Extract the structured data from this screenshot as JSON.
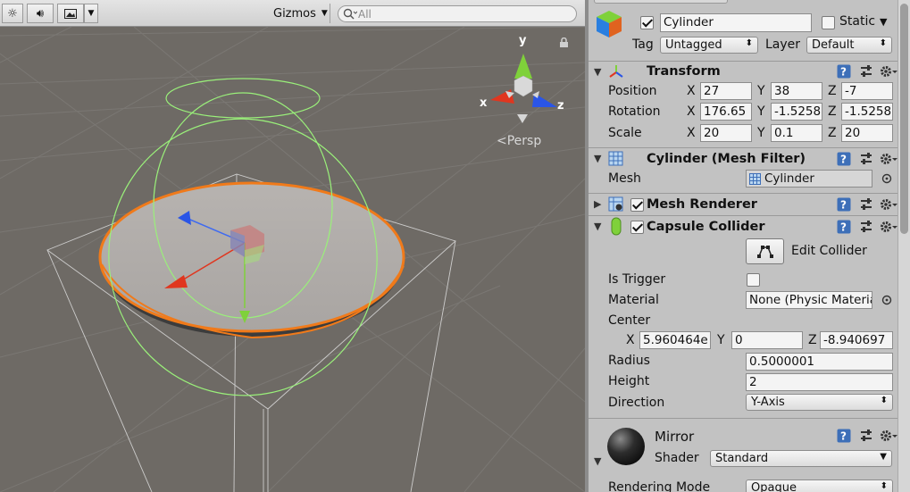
{
  "toolbar": {
    "gizmos_label": "Gizmos",
    "search_placeholder": "All",
    "icons": [
      "light-icon",
      "audio-icon",
      "effects-icon",
      "chevron-down-icon"
    ]
  },
  "scene": {
    "persp_label": "Persp",
    "axes": {
      "x": "x",
      "y": "y",
      "z": "z"
    }
  },
  "object": {
    "name": "Cylinder",
    "static_label": "Static",
    "tag_label": "Tag",
    "tag_value": "Untagged",
    "layer_label": "Layer",
    "layer_value": "Default"
  },
  "transform": {
    "title": "Transform",
    "rows": [
      {
        "label": "Position",
        "x": "27",
        "y": "38",
        "z": "-7"
      },
      {
        "label": "Rotation",
        "x": "176.65",
        "y": "-1.5258",
        "z": "-1.5258"
      },
      {
        "label": "Scale",
        "x": "20",
        "y": "0.1",
        "z": "20"
      }
    ]
  },
  "mesh_filter": {
    "title": "Cylinder (Mesh Filter)",
    "mesh_label": "Mesh",
    "mesh_value": "Cylinder"
  },
  "mesh_renderer": {
    "title": "Mesh Renderer",
    "enabled": true
  },
  "capsule_collider": {
    "title": "Capsule Collider",
    "enabled": true,
    "edit_collider_label": "Edit Collider",
    "is_trigger_label": "Is Trigger",
    "is_trigger": false,
    "material_label": "Material",
    "material_value": "None (Physic Material)",
    "center_label": "Center",
    "center": {
      "x": "5.960464e",
      "y": "0",
      "z": "-8.940697"
    },
    "radius_label": "Radius",
    "radius_value": "0.5000001",
    "height_label": "Height",
    "height_value": "2",
    "direction_label": "Direction",
    "direction_value": "Y-Axis"
  },
  "material": {
    "name": "Mirror",
    "shader_label": "Shader",
    "shader_value": "Standard",
    "rendering_mode_label": "Rendering Mode",
    "rendering_mode_value": "Opaque"
  },
  "colors": {
    "scene_bg": "#6e6a65",
    "inspector_bg": "#c2c2c2",
    "selection_outline": "#f07a1a",
    "collider_wire": "#9af07a",
    "axis_x": "#e0361f",
    "axis_y": "#7fd13a",
    "axis_z": "#2a55e6"
  }
}
